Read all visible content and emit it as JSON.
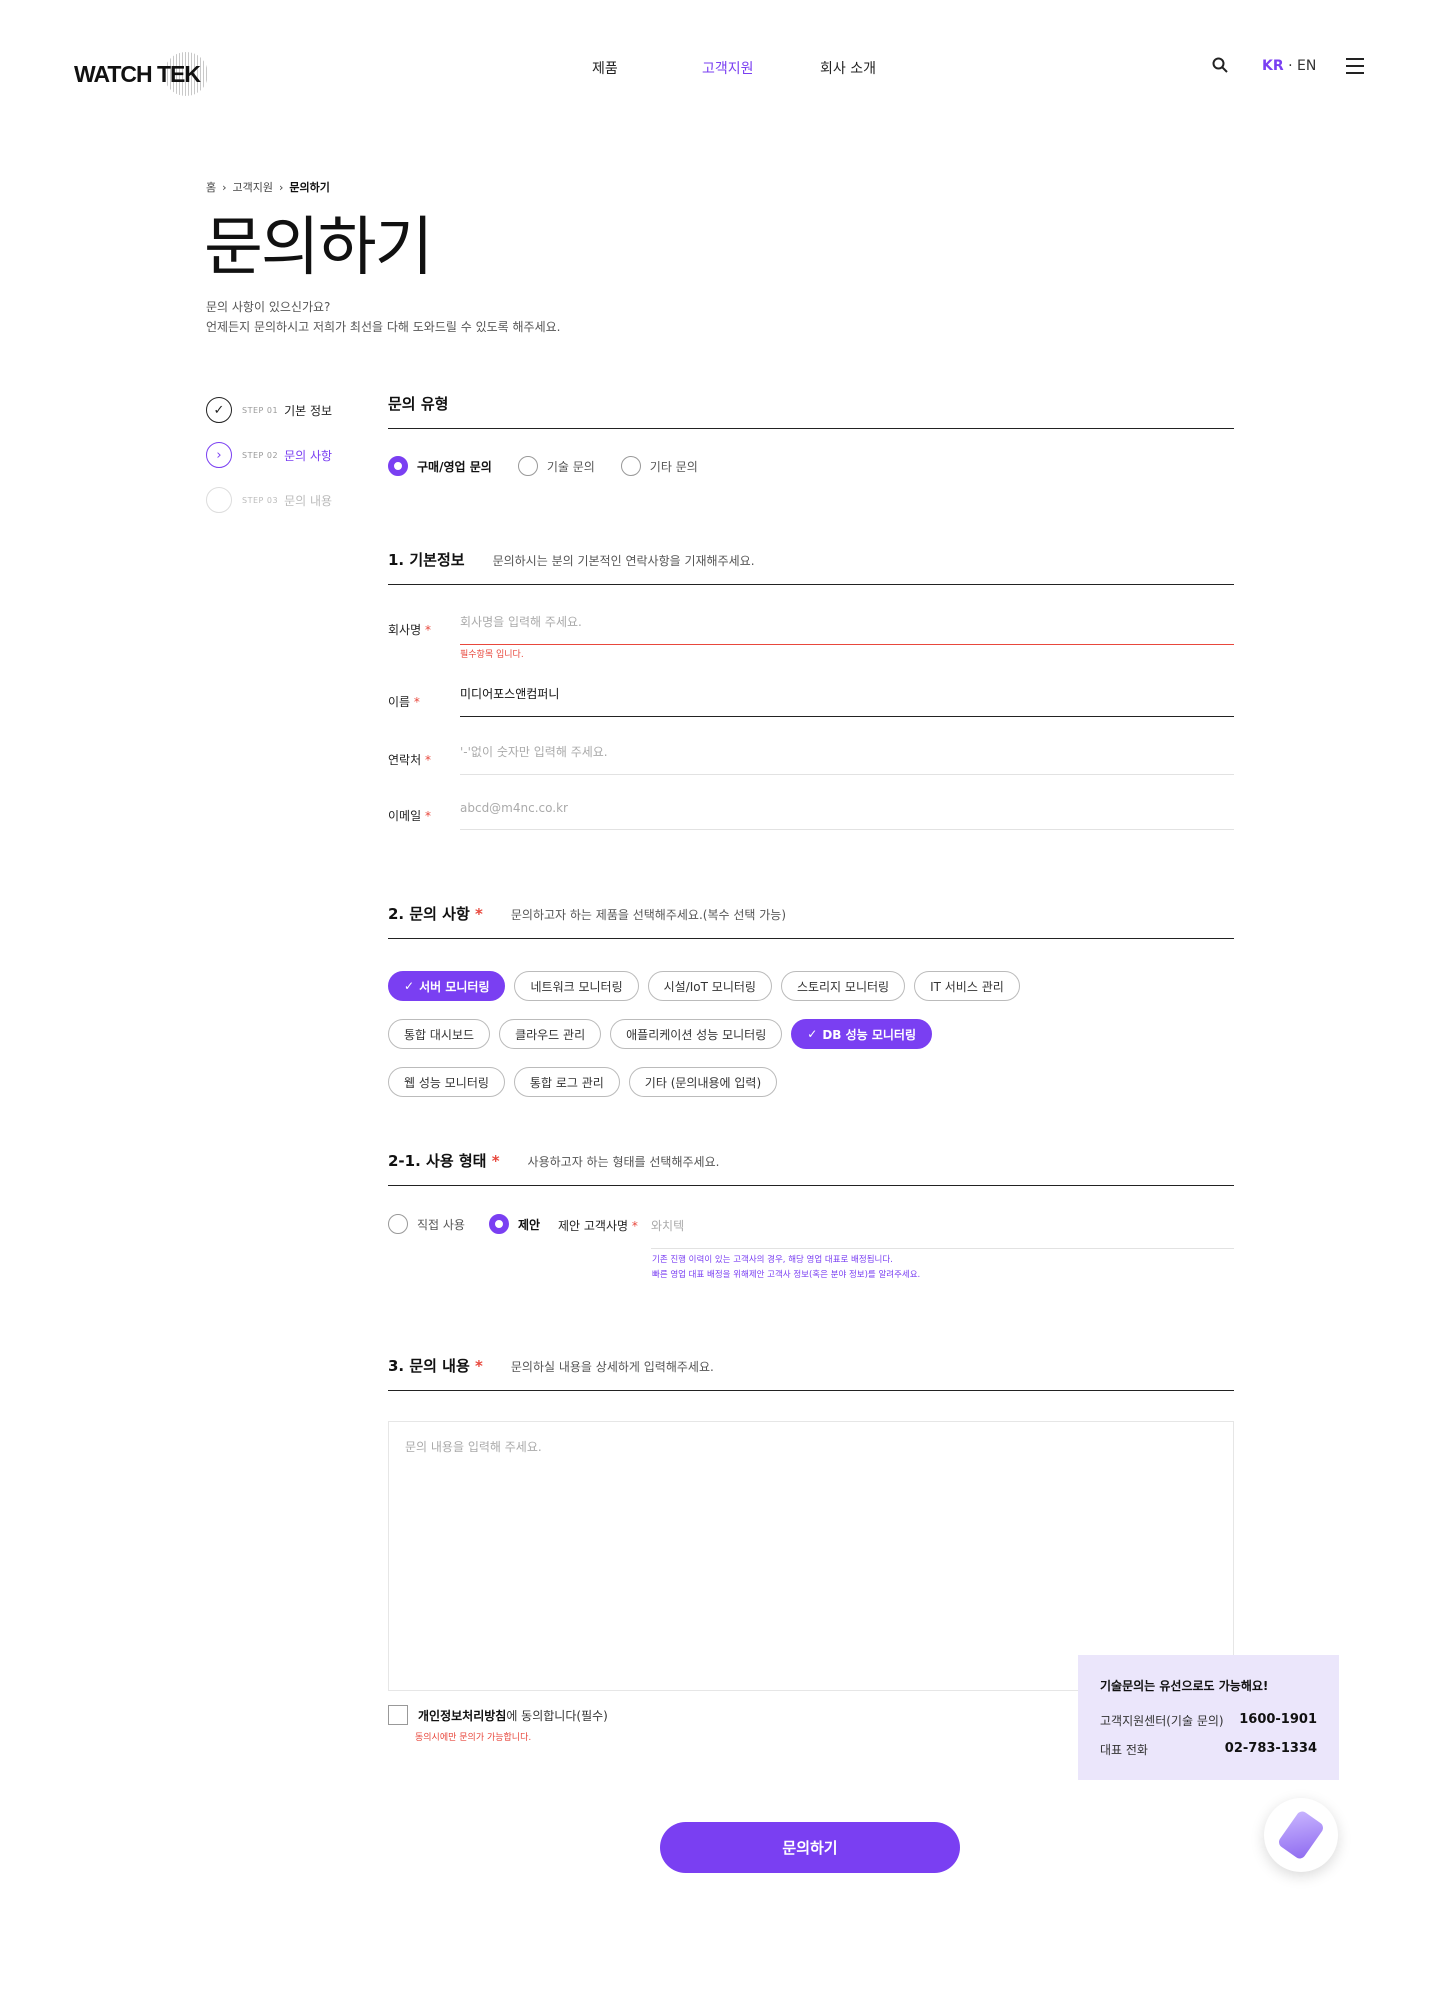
{
  "header": {
    "logo": "WATCH TEK",
    "nav": [
      "제품",
      "고객지원",
      "회사 소개"
    ],
    "lang_kr": "KR",
    "lang_sep": "·",
    "lang_en": "EN"
  },
  "breadcrumb": [
    "홈",
    "고객지원",
    "문의하기"
  ],
  "page": {
    "title": "문의하기",
    "desc_line1": "문의 사항이 있으신가요?",
    "desc_line2": "언제든지 문의하시고 저희가 최선을 다해 도와드릴 수 있도록 해주세요."
  },
  "steps": [
    {
      "tag": "STEP 01",
      "label": "기본 정보"
    },
    {
      "tag": "STEP 02",
      "label": "문의 사항"
    },
    {
      "tag": "STEP 03",
      "label": "문의 내용"
    }
  ],
  "inquiry_type": {
    "title": "문의 유형",
    "options": [
      "구매/영업 문의",
      "기술 문의",
      "기타 문의"
    ]
  },
  "basic": {
    "title": "1.  기본정보",
    "sub": "문의하시는 분의 기본적인 연락사항을 기재해주세요.",
    "company_label": "회사명",
    "company_placeholder": "회사명을 입력해 주세요.",
    "company_error": "필수항목 입니다.",
    "name_label": "이름",
    "name_value": "미디어포스앤컴퍼니",
    "phone_label": "연락처",
    "phone_placeholder": "'-'없이 숫자만 입력해 주세요.",
    "email_label": "이메일",
    "email_placeholder": "abcd@m4nc.co.kr",
    "required_mark": "*"
  },
  "inquiry": {
    "title": "2.  문의 사항",
    "sub": "문의하고자 하는 제품을 선택해주세요.(복수 선택 가능)",
    "chips": [
      {
        "label": "서버 모니터링",
        "selected": true
      },
      {
        "label": "네트워크 모니터링",
        "selected": false
      },
      {
        "label": "시설/IoT 모니터링",
        "selected": false
      },
      {
        "label": "스토리지 모니터링",
        "selected": false
      },
      {
        "label": "IT 서비스 관리",
        "selected": false
      },
      {
        "label": "통합 대시보드",
        "selected": false
      },
      {
        "label": "클라우드 관리",
        "selected": false
      },
      {
        "label": "애플리케이션 성능 모니터링",
        "selected": false
      },
      {
        "label": "DB 성능 모니터링",
        "selected": true
      },
      {
        "label": "웹 성능 모니터링",
        "selected": false
      },
      {
        "label": "통합 로그 관리",
        "selected": false
      },
      {
        "label": "기타 (문의내용에 입력)",
        "selected": false
      }
    ]
  },
  "usage": {
    "title": "2-1.  사용 형태",
    "sub": "사용하고자 하는 형태를 선택해주세요.",
    "options": [
      "직접 사용",
      "제안"
    ],
    "client_label": "제안 고객사명",
    "client_placeholder": "와치텍",
    "note_line1": "기존 진행 이력이 있는 고객사의 경우, 해당 영업 대표로 배정됩니다.",
    "note_line2": "빠른 영업 대표 배정을 위해제안 고객사 정보(혹은 분야 정보)를 알려주세요."
  },
  "content": {
    "title": "3.  문의 내용",
    "sub": "문의하실 내용을 상세하게 입력해주세요.",
    "placeholder": "문의 내용을 입력해 주세요."
  },
  "agree": {
    "link": "개인정보처리방침",
    "text": "에 동의합니다(필수)",
    "error": "동의시에만 문의가 가능합니다."
  },
  "submit_label": "문의하기",
  "call_card": {
    "title": "기술문의는 유선으로도 가능해요!",
    "rows": [
      {
        "label": "고객지원센터(기술 문의)",
        "value": "1600-1901"
      },
      {
        "label": "대표 전화",
        "value": "02-783-1334"
      }
    ]
  },
  "colors": {
    "accent": "#7a3ff2",
    "error": "#e8473c"
  },
  "icons": [
    "search-icon",
    "menu-icon",
    "check-icon",
    "chevron-right-icon",
    "phone-icon"
  ]
}
